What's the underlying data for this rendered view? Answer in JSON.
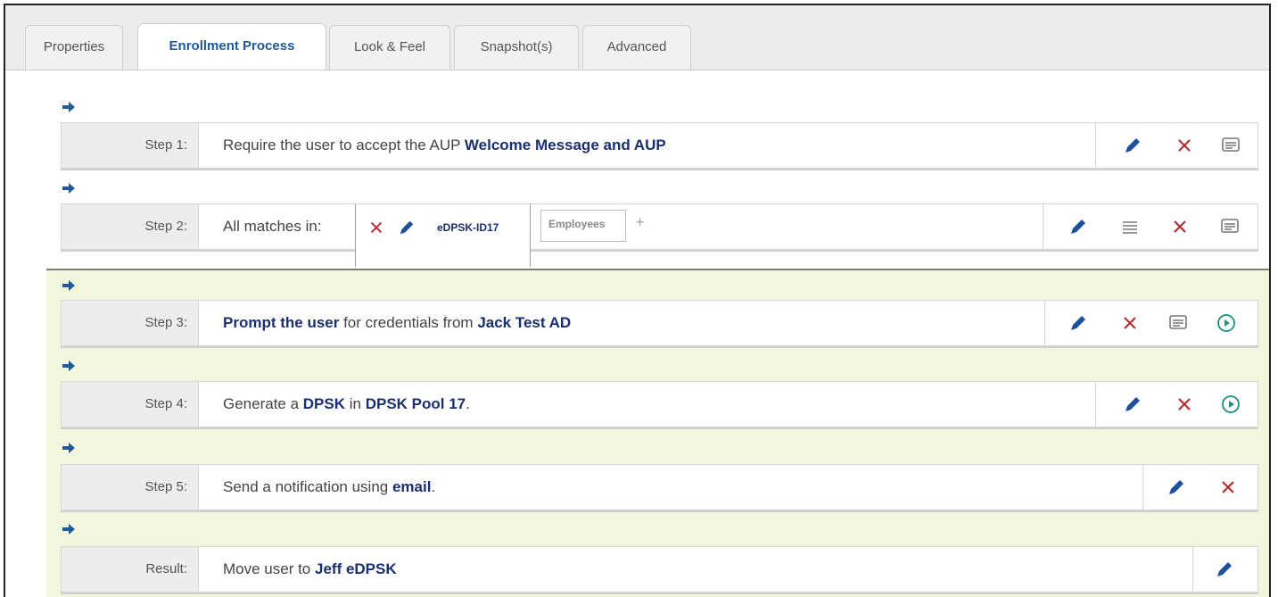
{
  "tabs": [
    "Properties",
    "Enrollment Process",
    "Look & Feel",
    "Snapshot(s)",
    "Advanced"
  ],
  "active_tab": "Enrollment Process",
  "steps": [
    {
      "label": "Step 1:",
      "parts": [
        "Require the user to accept the AUP ",
        "Welcome Message and AUP"
      ]
    },
    {
      "label": "Step 2:",
      "prefix": "All matches in:",
      "chips": [
        "eDPSK-ID17",
        "Employees"
      ],
      "add": "+"
    },
    {
      "label": "Step 3:",
      "parts": [
        "Prompt the user",
        " for credentials from ",
        "Jack Test AD"
      ]
    },
    {
      "label": "Step 4:",
      "parts": [
        "Generate a ",
        "DPSK",
        " in ",
        "DPSK Pool 17",
        "."
      ]
    },
    {
      "label": "Step 5:",
      "parts": [
        "Send a notification using ",
        "email",
        "."
      ]
    },
    {
      "label": "Result:",
      "parts": [
        "Move user to ",
        "Jeff eDPSK"
      ]
    }
  ],
  "colors": {
    "accent": "#1e5a9b",
    "delete": "#b03030",
    "green_zone": "#f0f7dc",
    "run": "#1a8f7a"
  }
}
